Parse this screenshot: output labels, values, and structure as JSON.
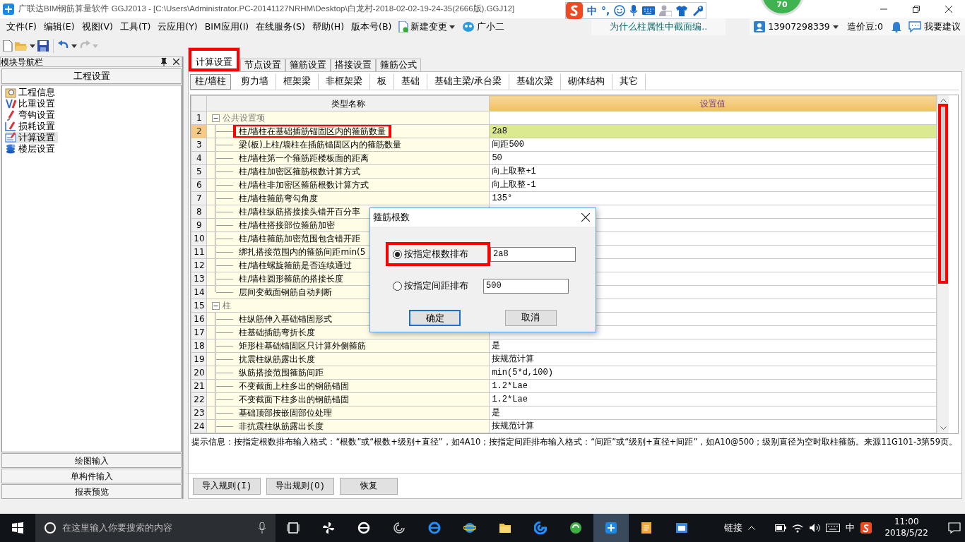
{
  "window": {
    "title": "广联达BIM钢筋算量软件 GGJ2013 - [C:\\Users\\Administrator.PC-20141127NRHM\\Desktop\\白龙村-2018-02-02-19-24-35(2666版).GGJ12]"
  },
  "ime_bar": {
    "mode": "中",
    "punct": "°,"
  },
  "floating_ball": {
    "value": "70"
  },
  "menu": [
    "文件(F)",
    "编辑(E)",
    "视图(V)",
    "工具(T)",
    "云应用(Y)",
    "BIM应用(I)",
    "在线服务(S)",
    "帮助(H)",
    "版本号(B)"
  ],
  "menu_tools": {
    "new_change": "新建变更",
    "assistant": "广小二"
  },
  "header_right": {
    "question": "为什么柱属性中截面编..",
    "account": "13907298339",
    "points": "造价豆:0",
    "suggest": "我要建议"
  },
  "toolbar": {
    "redo": {
      "disabled": true
    }
  },
  "nav_panel": {
    "title": "模块导航栏",
    "section": "工程设置",
    "items": [
      {
        "label": "工程信息",
        "selected": false
      },
      {
        "label": "比重设置",
        "selected": false
      },
      {
        "label": "弯钩设置",
        "selected": false
      },
      {
        "label": "损耗设置",
        "selected": false
      },
      {
        "label": "计算设置",
        "selected": true
      },
      {
        "label": "楼层设置",
        "selected": false
      }
    ],
    "footer_buttons": [
      "绘图输入",
      "单构件输入",
      "报表预览"
    ]
  },
  "tabs": [
    {
      "label": "计算设置",
      "selected": true,
      "highlighted": true
    },
    {
      "label": "节点设置",
      "selected": false,
      "highlighted": false
    },
    {
      "label": "箍筋设置",
      "selected": false,
      "highlighted": false
    },
    {
      "label": "搭接设置",
      "selected": false,
      "highlighted": false
    },
    {
      "label": "箍筋公式",
      "selected": false,
      "highlighted": false
    }
  ],
  "subtabs": [
    {
      "label": "柱/墙柱",
      "selected": true
    },
    {
      "label": "剪力墙",
      "selected": false
    },
    {
      "label": "框架梁",
      "selected": false
    },
    {
      "label": "非框架梁",
      "selected": false
    },
    {
      "label": "板",
      "selected": false
    },
    {
      "label": "基础",
      "selected": false
    },
    {
      "label": "基础主梁/承台梁",
      "selected": false
    },
    {
      "label": "基础次梁",
      "selected": false
    },
    {
      "label": "砌体结构",
      "selected": false
    },
    {
      "label": "其它",
      "selected": false
    }
  ],
  "table": {
    "columns": [
      "类型名称",
      "设置值"
    ],
    "rows": [
      {
        "number": "1",
        "label": "公共设置项",
        "expanded": true,
        "selected": false,
        "children": [
          {
            "number": "2",
            "label": "柱/墙柱在基础插筋锚固区内的箍筋数量",
            "value": "2a8",
            "selected": true,
            "highlighted": true
          },
          {
            "number": "3",
            "label": "梁(板)上柱/墙柱在插筋锚固区内的箍筋数量",
            "value": "间距500",
            "selected": false,
            "highlighted": false
          },
          {
            "number": "4",
            "label": "柱/墙柱第一个箍筋距楼板面的距离",
            "value": "50",
            "selected": false,
            "highlighted": false
          },
          {
            "number": "5",
            "label": "柱/墙柱加密区箍筋根数计算方式",
            "value": "向上取整+1",
            "selected": false,
            "highlighted": false
          },
          {
            "number": "6",
            "label": "柱/墙柱非加密区箍筋根数计算方式",
            "value": "向上取整-1",
            "selected": false,
            "highlighted": false
          },
          {
            "number": "7",
            "label": "柱/墙柱箍筋弯勾角度",
            "value": "135°",
            "selected": false,
            "highlighted": false
          },
          {
            "number": "8",
            "label": "柱/墙柱纵筋搭接接头错开百分率",
            "selected": false,
            "highlighted": false
          },
          {
            "number": "9",
            "label": "柱/墙柱搭接部位箍筋加密",
            "selected": false,
            "highlighted": false
          },
          {
            "number": "10",
            "label": "柱/墙柱箍筋加密范围包含错开距",
            "selected": false,
            "highlighted": false
          },
          {
            "number": "11",
            "label": "绑扎搭接范围内的箍筋间距min(5",
            "selected": false,
            "highlighted": false
          },
          {
            "number": "12",
            "label": "柱/墙柱螺旋箍筋是否连续通过",
            "selected": false,
            "highlighted": false
          },
          {
            "number": "13",
            "label": "柱/墙柱圆形箍筋的搭接长度",
            "selected": false,
            "highlighted": false
          },
          {
            "number": "14",
            "label": "层间变截面钢筋自动判断",
            "selected": false,
            "highlighted": false
          }
        ]
      },
      {
        "number": "15",
        "label": "柱",
        "expanded": true,
        "selected": false,
        "children": [
          {
            "number": "16",
            "label": "柱纵筋伸入基础锚固形式",
            "selected": false,
            "highlighted": false
          },
          {
            "number": "17",
            "label": "柱基础插筋弯折长度",
            "selected": false,
            "highlighted": false
          },
          {
            "number": "18",
            "label": "矩形柱基础锚固区只计算外侧箍筋",
            "value": "是",
            "selected": false,
            "highlighted": false
          },
          {
            "number": "19",
            "label": "抗震柱纵筋露出长度",
            "value": "按规范计算",
            "selected": false,
            "highlighted": false
          },
          {
            "number": "20",
            "label": "纵筋搭接范围箍筋间距",
            "value": "min(5*d,100)",
            "selected": false,
            "highlighted": false
          },
          {
            "number": "21",
            "label": "不变截面上柱多出的钢筋锚固",
            "value": "1.2*Lae",
            "selected": false,
            "highlighted": false
          },
          {
            "number": "22",
            "label": "不变截面下柱多出的钢筋锚固",
            "value": "1.2*Lae",
            "selected": false,
            "highlighted": false
          },
          {
            "number": "23",
            "label": "基础顶部按嵌固部位处理",
            "value": "是",
            "selected": false,
            "highlighted": false
          },
          {
            "number": "24",
            "label": "非抗震柱纵筋露出长度",
            "value": "按规范计算",
            "selected": false,
            "highlighted": false
          }
        ]
      }
    ]
  },
  "scrollbar": {
    "highlighted": true
  },
  "hint": "提示信息：按指定根数排布输入格式：“根数”或“根数+级别+直径”，如4A10；按指定间距排布输入格式：“间距”或“级别+直径+间距”，如A10@500；级别直径为空时取柱箍筋。来源11G101-3第59页。",
  "buttons": [
    "导入规则(I)",
    "导出规则(O)",
    "恢复"
  ],
  "dialog": {
    "title": "箍筋根数",
    "options": [
      {
        "label": "按指定根数排布",
        "value": "2a8",
        "selected": true,
        "highlighted": true
      },
      {
        "label": "按指定间距排布",
        "value": "500",
        "selected": false,
        "highlighted": false
      }
    ],
    "buttons": [
      {
        "label": "确定",
        "focused": true
      },
      {
        "label": "取消",
        "focused": false
      }
    ]
  },
  "taskbar": {
    "search_placeholder": "在这里输入你要搜索的内容",
    "links": "链接",
    "ime": "中",
    "time": "11:00",
    "date": "2018/5/22"
  }
}
